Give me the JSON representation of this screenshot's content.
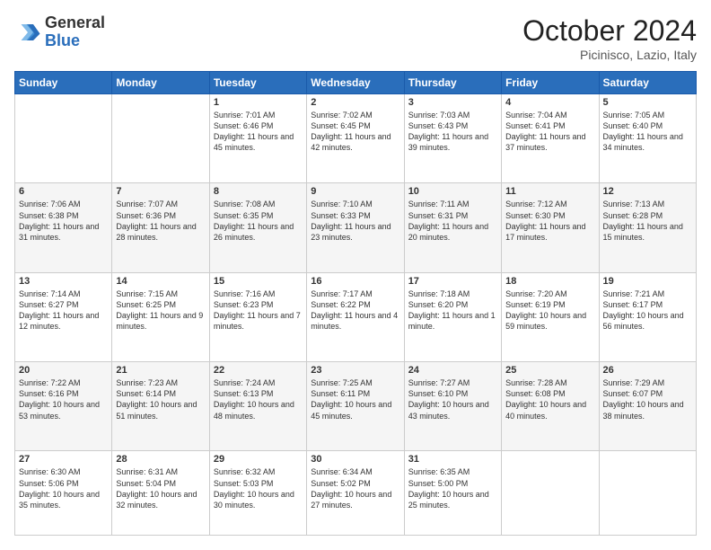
{
  "header": {
    "logo_general": "General",
    "logo_blue": "Blue",
    "month": "October 2024",
    "location": "Picinisco, Lazio, Italy"
  },
  "days_of_week": [
    "Sunday",
    "Monday",
    "Tuesday",
    "Wednesday",
    "Thursday",
    "Friday",
    "Saturday"
  ],
  "weeks": [
    [
      {
        "num": "",
        "content": ""
      },
      {
        "num": "",
        "content": ""
      },
      {
        "num": "1",
        "content": "Sunrise: 7:01 AM\nSunset: 6:46 PM\nDaylight: 11 hours and 45 minutes."
      },
      {
        "num": "2",
        "content": "Sunrise: 7:02 AM\nSunset: 6:45 PM\nDaylight: 11 hours and 42 minutes."
      },
      {
        "num": "3",
        "content": "Sunrise: 7:03 AM\nSunset: 6:43 PM\nDaylight: 11 hours and 39 minutes."
      },
      {
        "num": "4",
        "content": "Sunrise: 7:04 AM\nSunset: 6:41 PM\nDaylight: 11 hours and 37 minutes."
      },
      {
        "num": "5",
        "content": "Sunrise: 7:05 AM\nSunset: 6:40 PM\nDaylight: 11 hours and 34 minutes."
      }
    ],
    [
      {
        "num": "6",
        "content": "Sunrise: 7:06 AM\nSunset: 6:38 PM\nDaylight: 11 hours and 31 minutes."
      },
      {
        "num": "7",
        "content": "Sunrise: 7:07 AM\nSunset: 6:36 PM\nDaylight: 11 hours and 28 minutes."
      },
      {
        "num": "8",
        "content": "Sunrise: 7:08 AM\nSunset: 6:35 PM\nDaylight: 11 hours and 26 minutes."
      },
      {
        "num": "9",
        "content": "Sunrise: 7:10 AM\nSunset: 6:33 PM\nDaylight: 11 hours and 23 minutes."
      },
      {
        "num": "10",
        "content": "Sunrise: 7:11 AM\nSunset: 6:31 PM\nDaylight: 11 hours and 20 minutes."
      },
      {
        "num": "11",
        "content": "Sunrise: 7:12 AM\nSunset: 6:30 PM\nDaylight: 11 hours and 17 minutes."
      },
      {
        "num": "12",
        "content": "Sunrise: 7:13 AM\nSunset: 6:28 PM\nDaylight: 11 hours and 15 minutes."
      }
    ],
    [
      {
        "num": "13",
        "content": "Sunrise: 7:14 AM\nSunset: 6:27 PM\nDaylight: 11 hours and 12 minutes."
      },
      {
        "num": "14",
        "content": "Sunrise: 7:15 AM\nSunset: 6:25 PM\nDaylight: 11 hours and 9 minutes."
      },
      {
        "num": "15",
        "content": "Sunrise: 7:16 AM\nSunset: 6:23 PM\nDaylight: 11 hours and 7 minutes."
      },
      {
        "num": "16",
        "content": "Sunrise: 7:17 AM\nSunset: 6:22 PM\nDaylight: 11 hours and 4 minutes."
      },
      {
        "num": "17",
        "content": "Sunrise: 7:18 AM\nSunset: 6:20 PM\nDaylight: 11 hours and 1 minute."
      },
      {
        "num": "18",
        "content": "Sunrise: 7:20 AM\nSunset: 6:19 PM\nDaylight: 10 hours and 59 minutes."
      },
      {
        "num": "19",
        "content": "Sunrise: 7:21 AM\nSunset: 6:17 PM\nDaylight: 10 hours and 56 minutes."
      }
    ],
    [
      {
        "num": "20",
        "content": "Sunrise: 7:22 AM\nSunset: 6:16 PM\nDaylight: 10 hours and 53 minutes."
      },
      {
        "num": "21",
        "content": "Sunrise: 7:23 AM\nSunset: 6:14 PM\nDaylight: 10 hours and 51 minutes."
      },
      {
        "num": "22",
        "content": "Sunrise: 7:24 AM\nSunset: 6:13 PM\nDaylight: 10 hours and 48 minutes."
      },
      {
        "num": "23",
        "content": "Sunrise: 7:25 AM\nSunset: 6:11 PM\nDaylight: 10 hours and 45 minutes."
      },
      {
        "num": "24",
        "content": "Sunrise: 7:27 AM\nSunset: 6:10 PM\nDaylight: 10 hours and 43 minutes."
      },
      {
        "num": "25",
        "content": "Sunrise: 7:28 AM\nSunset: 6:08 PM\nDaylight: 10 hours and 40 minutes."
      },
      {
        "num": "26",
        "content": "Sunrise: 7:29 AM\nSunset: 6:07 PM\nDaylight: 10 hours and 38 minutes."
      }
    ],
    [
      {
        "num": "27",
        "content": "Sunrise: 6:30 AM\nSunset: 5:06 PM\nDaylight: 10 hours and 35 minutes."
      },
      {
        "num": "28",
        "content": "Sunrise: 6:31 AM\nSunset: 5:04 PM\nDaylight: 10 hours and 32 minutes."
      },
      {
        "num": "29",
        "content": "Sunrise: 6:32 AM\nSunset: 5:03 PM\nDaylight: 10 hours and 30 minutes."
      },
      {
        "num": "30",
        "content": "Sunrise: 6:34 AM\nSunset: 5:02 PM\nDaylight: 10 hours and 27 minutes."
      },
      {
        "num": "31",
        "content": "Sunrise: 6:35 AM\nSunset: 5:00 PM\nDaylight: 10 hours and 25 minutes."
      },
      {
        "num": "",
        "content": ""
      },
      {
        "num": "",
        "content": ""
      }
    ]
  ]
}
